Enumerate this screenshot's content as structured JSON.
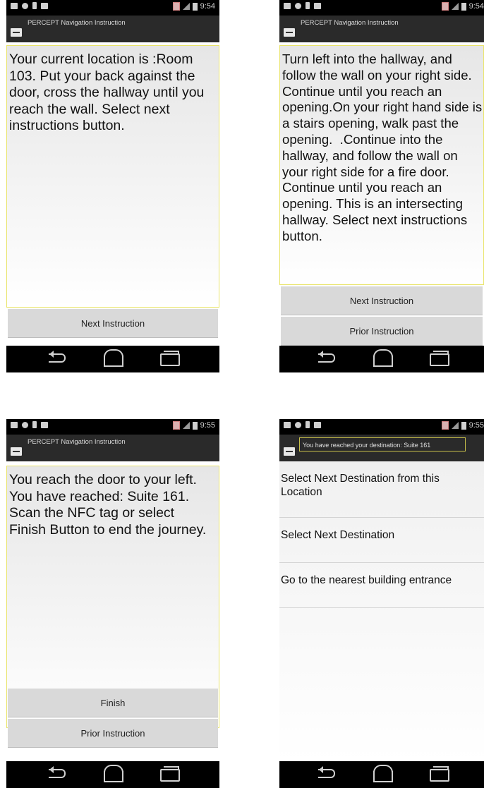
{
  "status": {
    "time_1": "9:54",
    "time_2": "9:54",
    "time_3": "9:55",
    "time_4": "9:55"
  },
  "app": {
    "title": "PERCEPT Navigation Instruction"
  },
  "screen1": {
    "instruction": "Your current location is :Room 103. Put your back against the door, cross the hallway until you reach the wall. Select next instructions button.",
    "next_label": "Next Instruction"
  },
  "screen2": {
    "instruction": "Turn left into the hallway, and follow the wall on your right side. Continue until you reach an opening.On your right hand side is a stairs opening, walk past the opening.  .Continue into the hallway, and follow the wall on your right side for a fire door. Continue until you reach an opening. This is an intersecting hallway. Select next instructions button.",
    "next_label": "Next Instruction",
    "prior_label": "Prior Instruction"
  },
  "screen3": {
    "instruction": "You reach the door to your left. You have reached: Suite 161. Scan the NFC tag or select Finish Button to end the journey.",
    "finish_label": "Finish",
    "prior_label": "Prior Instruction"
  },
  "screen4": {
    "title": "You have reached your destination: Suite 161",
    "items": [
      "Select Next Destination from this Location",
      "Select Next Destination",
      "Go to the nearest building entrance"
    ]
  }
}
